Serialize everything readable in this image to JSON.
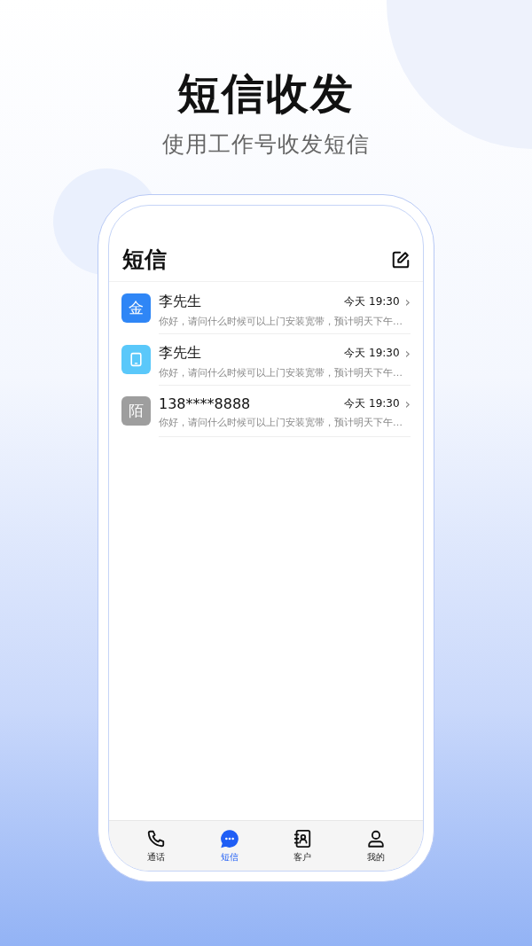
{
  "promo": {
    "title": "短信收发",
    "subtitle": "使用工作号收发短信"
  },
  "screen": {
    "title": "短信",
    "messages": [
      {
        "kind": "text",
        "avatar": "金",
        "color": "#2f86f6",
        "name": "李先生",
        "time": "今天 19:30",
        "chevron": "›",
        "preview": "你好，请问什么时候可以上门安装宽带，预计明天下午…"
      },
      {
        "kind": "icon",
        "color": "#5ac8fa",
        "name": "李先生",
        "time": "今天 19:30",
        "chevron": "›",
        "preview": "你好，请问什么时候可以上门安装宽带，预计明天下午…"
      },
      {
        "kind": "text",
        "avatar": "陌",
        "color": "#9e9e9e",
        "name": "138****8888",
        "time": "今天 19:30",
        "chevron": "›",
        "preview": "你好，请问什么时候可以上门安装宽带，预计明天下午…"
      }
    ],
    "tabs": [
      {
        "kind": "phone",
        "label": "通话",
        "selected": false
      },
      {
        "kind": "chat",
        "label": "短信",
        "selected": true
      },
      {
        "kind": "contacts",
        "label": "客户",
        "selected": false
      },
      {
        "kind": "person",
        "label": "我的",
        "selected": false
      }
    ]
  }
}
